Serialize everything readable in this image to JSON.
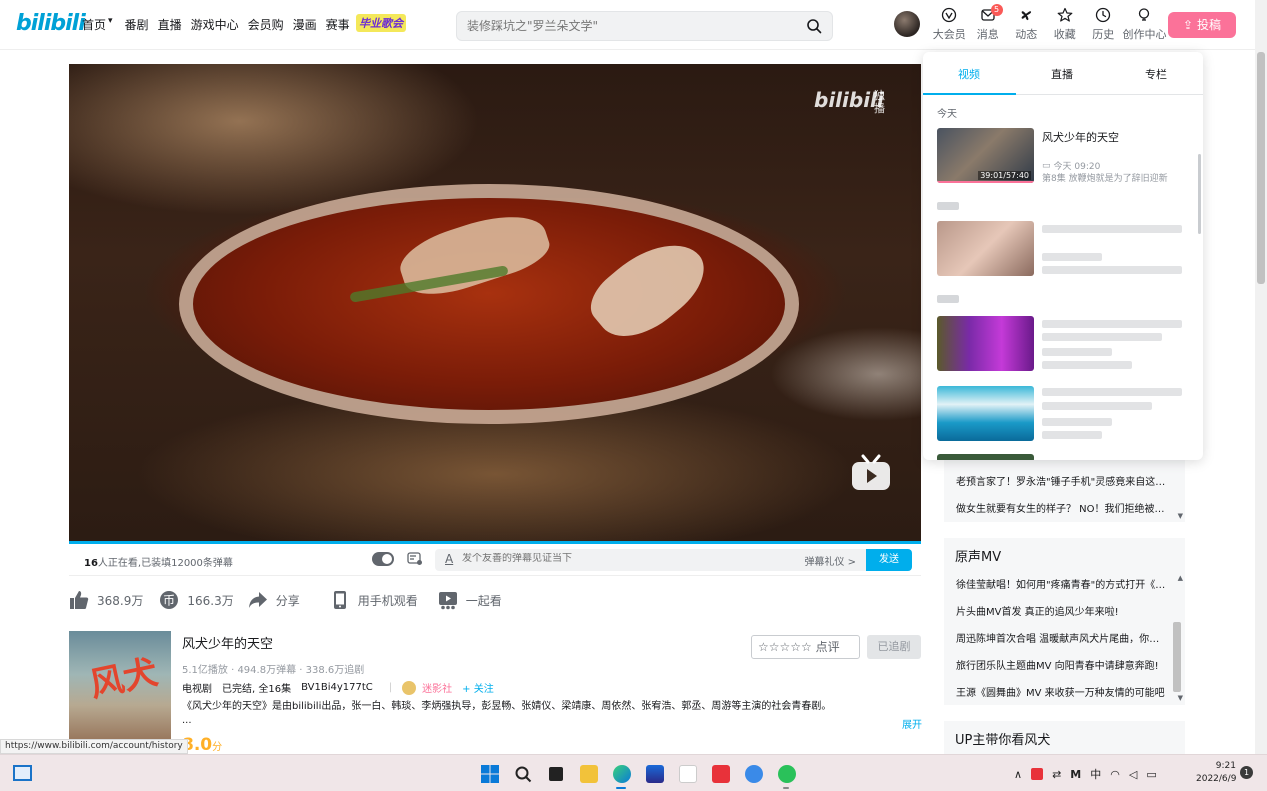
{
  "header": {
    "logo": "bilibili",
    "nav": [
      "首页",
      "番剧",
      "直播",
      "游戏中心",
      "会员购",
      "漫画",
      "赛事"
    ],
    "nav_badge": "毕业歌会",
    "search_placeholder": "装修踩坑之\"罗兰朵文学\"",
    "message_count": "5",
    "icons": [
      {
        "label": "大会员",
        "icon": "vip-icon"
      },
      {
        "label": "消息",
        "icon": "message-icon"
      },
      {
        "label": "动态",
        "icon": "dynamic-icon"
      },
      {
        "label": "收藏",
        "icon": "star-icon"
      },
      {
        "label": "历史",
        "icon": "history-icon"
      },
      {
        "label": "创作中心",
        "icon": "bulb-icon"
      }
    ],
    "upload_label": "投稿"
  },
  "player": {
    "watermark": "bilibili",
    "watermark_sub": "独播",
    "viewers_count": "16",
    "viewers_text": "人正在看,已装填12000条弹幕",
    "danmaku_placeholder": "发个友善的弹幕见证当下",
    "danmaku_etiquette": "弹幕礼仪 >",
    "send_label": "发送"
  },
  "actions": [
    {
      "label": "368.9万",
      "icon": "thumb-up-icon"
    },
    {
      "label": "166.3万",
      "icon": "coin-icon"
    },
    {
      "label": "分享",
      "icon": "share-icon"
    },
    {
      "label": "用手机观看",
      "icon": "phone-icon"
    },
    {
      "label": "一起看",
      "icon": "watch-together-icon"
    }
  ],
  "info": {
    "poster_text": "风犬",
    "title": "风犬少年的天空",
    "stats": "5.1亿播放 · 494.8万弹幕 · 338.6万追剧",
    "type": "电视剧",
    "status": "已完结, 全16集",
    "bvid": "BV1Bi4y177tC",
    "org": "迷影社",
    "follow": "+ 关注",
    "description": "《风犬少年的天空》是由bilibili出品，张一白、韩琰、李炳强执导，彭昱畅、张婧仪、梁靖康、周依然、张宥浩、郭丞、周游等主演的社会青春剧。",
    "ellipsis": "...",
    "expand": "展开",
    "score": "8.0",
    "score_unit": "分",
    "rate_stars": "☆☆☆☆☆",
    "rate_label": "点评",
    "followed_label": "已追剧"
  },
  "sidebar": {
    "list_items": [
      "老预言家了！罗永浩\"锤子手机\"灵感竟来自这里？？",
      "做女生就要有女生的样子？ NO！我们拒绝被定义！"
    ],
    "mv_title": "原声MV",
    "mv_items": [
      "徐佳莹献唱！如何用\"疼痛青春\"的方式打开《风犬少年的天空》",
      "片头曲MV首发 真正的追风少年来啦!",
      "周迅陈坤首次合唱 温暖献声风犬片尾曲，你的旧时光",
      "旅行团乐队主题曲MV 向阳青春中请肆意奔跑!",
      "王源《圆舞曲》MV 来收获一万种友情的可能吧"
    ],
    "up_title": "UP主带你看风犬"
  },
  "history": {
    "tabs": [
      "视频",
      "直播",
      "专栏"
    ],
    "today_label": "今天",
    "item": {
      "title": "风犬少年的天空",
      "duration": "39:01/57:40",
      "time": "今天 09:20",
      "episode": "第8集 放鞭炮就是为了辞旧迎新"
    }
  },
  "status_url": "https://www.bilibili.com/account/history",
  "taskbar": {
    "tray_ime": "中",
    "time": "9:21",
    "date": "2022/6/9",
    "notify_count": "1"
  }
}
